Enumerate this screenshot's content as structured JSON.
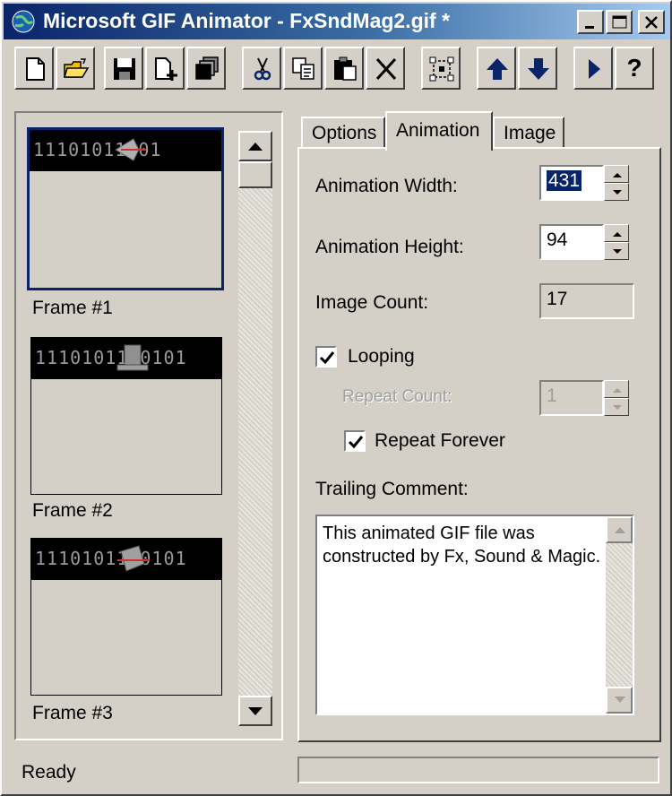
{
  "window": {
    "title": "Microsoft GIF Animator - FxSndMag2.gif *"
  },
  "toolbar": {
    "buttons": [
      {
        "name": "new",
        "icon": "new-document-icon"
      },
      {
        "name": "open",
        "icon": "open-folder-icon"
      },
      {
        "name": "save",
        "icon": "floppy-disk-icon"
      },
      {
        "name": "insert",
        "icon": "insert-document-icon"
      },
      {
        "name": "save-as",
        "icon": "stacked-frames-icon"
      },
      {
        "name": "cut",
        "icon": "scissors-icon"
      },
      {
        "name": "copy",
        "icon": "copy-icon"
      },
      {
        "name": "paste",
        "icon": "paste-clipboard-icon"
      },
      {
        "name": "delete",
        "icon": "x-delete-icon"
      },
      {
        "name": "select-all",
        "icon": "select-all-icon"
      },
      {
        "name": "move-up",
        "icon": "arrow-up-icon"
      },
      {
        "name": "move-down",
        "icon": "arrow-down-icon"
      },
      {
        "name": "preview",
        "icon": "play-triangle-icon"
      },
      {
        "name": "help",
        "icon": "help-question-icon",
        "label": "?"
      }
    ]
  },
  "frames": [
    {
      "label": "Frame #1",
      "strip": "11101011101"
    },
    {
      "label": "Frame #2",
      "strip": "1110101110101"
    },
    {
      "label": "Frame #3",
      "strip": "1110101110101"
    }
  ],
  "tabs": [
    {
      "label": "Options"
    },
    {
      "label": "Animation"
    },
    {
      "label": "Image"
    }
  ],
  "animation": {
    "width_label": "Animation Width:",
    "width_value": "431",
    "height_label": "Animation Height:",
    "height_value": "94",
    "count_label": "Image Count:",
    "count_value": "17",
    "looping_label": "Looping",
    "repeat_count_label": "Repeat Count:",
    "repeat_count_value": "1",
    "repeat_forever_label": "Repeat Forever",
    "comment_label": "Trailing Comment:",
    "comment_text": "This animated GIF file was constructed by Fx, Sound & Magic."
  },
  "status": {
    "text": "Ready"
  },
  "colors": {
    "face": "#d4d0c8",
    "title_start": "#0a246a",
    "title_end": "#a6caf0",
    "icon_blue": "#0a246a",
    "folder_yellow": "#f0c000"
  }
}
